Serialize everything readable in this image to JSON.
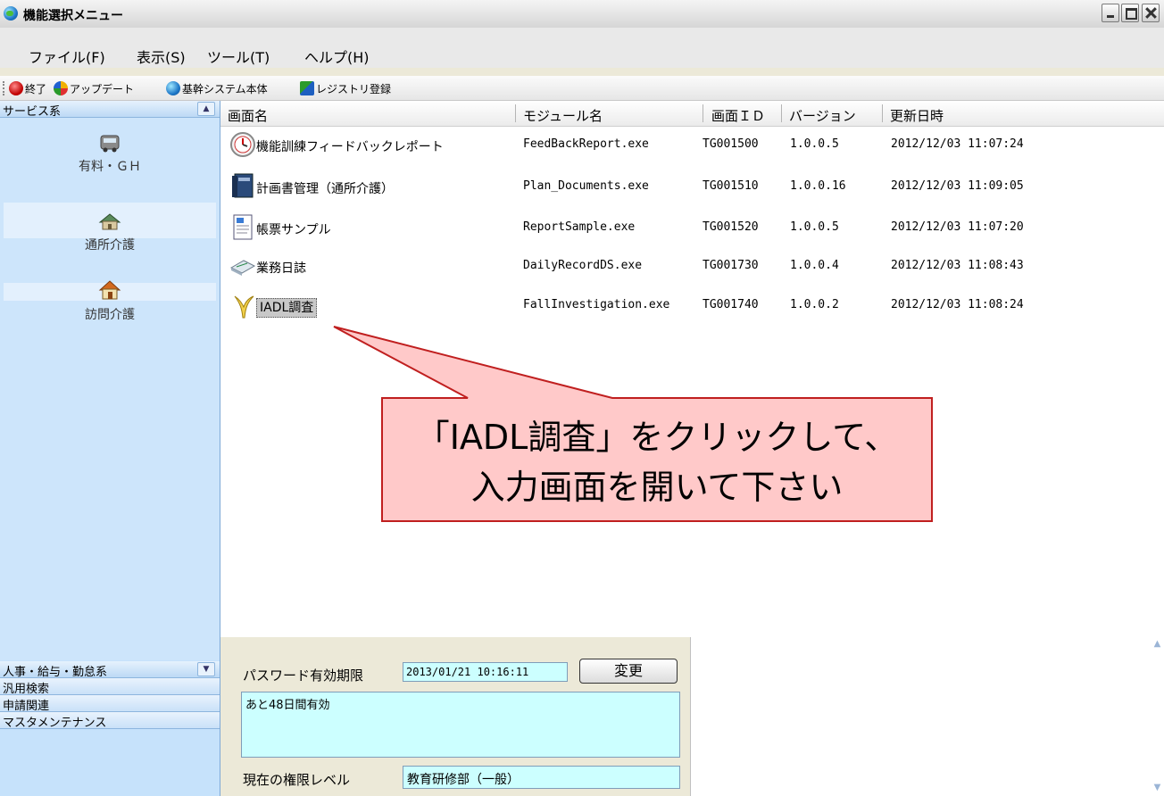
{
  "window": {
    "title": "機能選択メニュー"
  },
  "menu": [
    "ファイル(F)",
    "表示(S)",
    "ツール(T)",
    "ヘルプ(H)"
  ],
  "toolbar": {
    "exit": "終了",
    "update": "アップデート",
    "core": "基幹システム本体",
    "registry": "レジストリ登録"
  },
  "sidebar": {
    "service_header": "サービス系",
    "entries": [
      "有料・ＧＨ",
      "通所介護",
      "訪問介護"
    ],
    "bottom_items": [
      "人事・給与・勤怠系",
      "汎用検索",
      "申請関連",
      "マスタメンテナンス"
    ]
  },
  "columns": [
    "画面名",
    "モジュール名",
    "画面ＩＤ",
    "バージョン",
    "更新日時"
  ],
  "rows": [
    {
      "name": "機能訓練フィードバックレポート",
      "module": "FeedBackReport.exe",
      "id": "TG001500",
      "version": "1.0.0.5",
      "updated": "2012/12/03 11:07:24",
      "icon": "clock-icon"
    },
    {
      "name": "計画書管理（通所介護）",
      "module": "Plan_Documents.exe",
      "id": "TG001510",
      "version": "1.0.0.16",
      "updated": "2012/12/03 11:09:05",
      "icon": "binder-icon"
    },
    {
      "name": "帳票サンプル",
      "module": "ReportSample.exe",
      "id": "TG001520",
      "version": "1.0.0.5",
      "updated": "2012/12/03 11:07:20",
      "icon": "document-icon"
    },
    {
      "name": "業務日誌",
      "module": "DailyRecordDS.exe",
      "id": "TG001730",
      "version": "1.0.0.4",
      "updated": "2012/12/03 11:08:43",
      "icon": "notebook-icon"
    },
    {
      "name": "IADL調査",
      "module": "FallInvestigation.exe",
      "id": "TG001740",
      "version": "1.0.0.2",
      "updated": "2012/12/03 11:08:24",
      "icon": "banana-peel-icon"
    }
  ],
  "bottom": {
    "password_label": "パスワード有効期限",
    "password_expiry": "2013/01/21 10:16:11",
    "change_button": "変更",
    "remaining": "あと48日間有効",
    "auth_label": "現在の権限レベル",
    "auth_level": "教育研修部（一般）"
  },
  "callout": {
    "line1": "「IADL調査」をクリックして、",
    "line2": "入力画面を開いて下さい"
  },
  "colors": {
    "background": "#ffff66",
    "callout_fill": "#ffc9c9",
    "callout_border": "#c01f1f",
    "input_fill": "#ccffff"
  }
}
